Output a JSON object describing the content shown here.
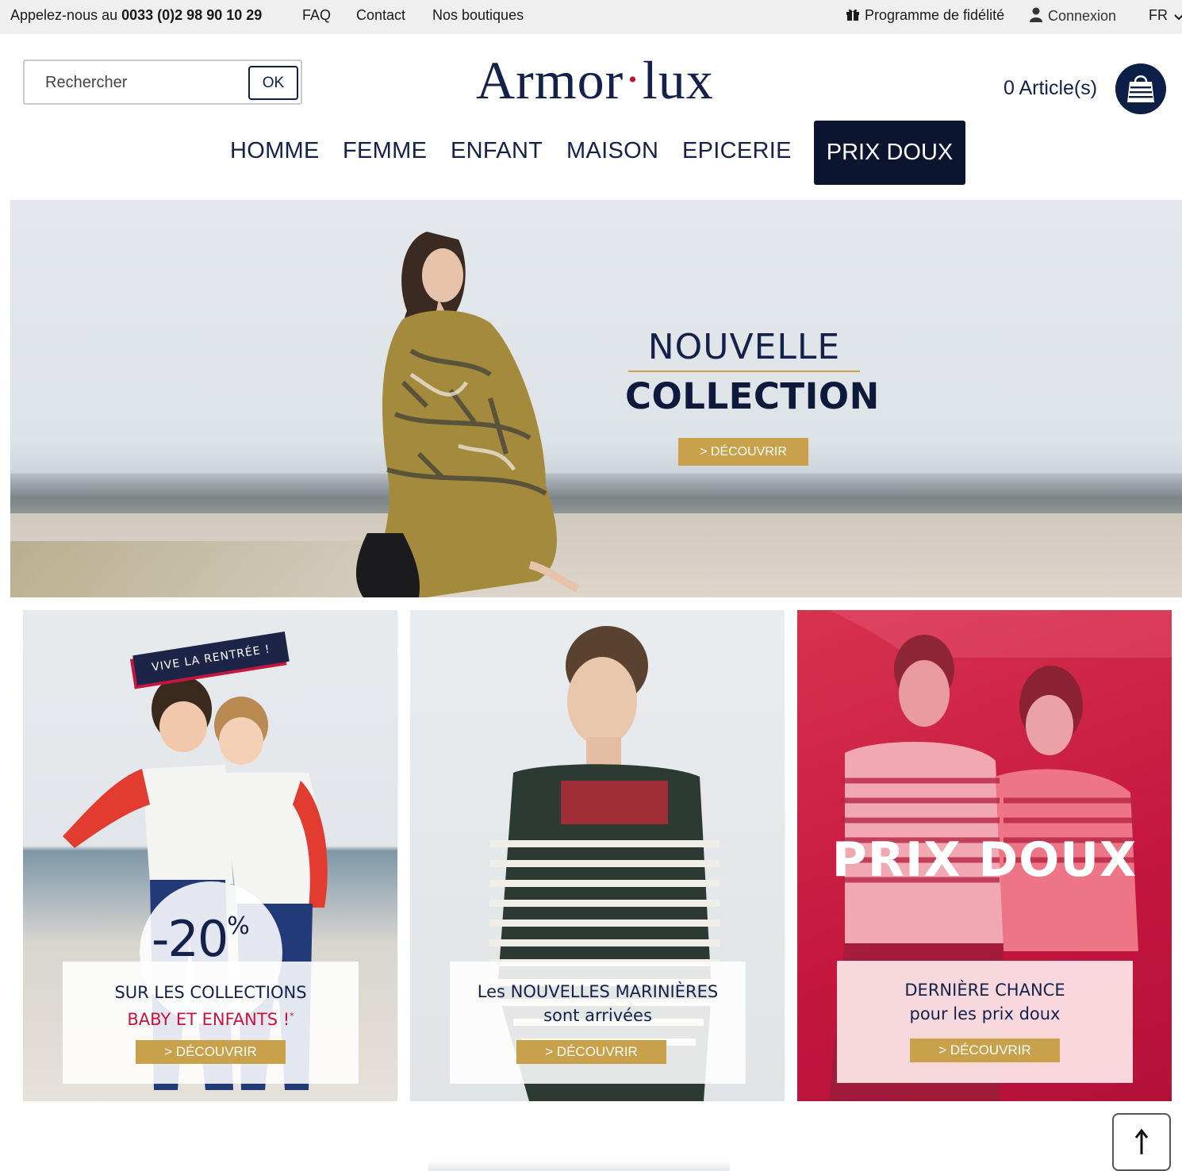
{
  "topbar": {
    "phone_prefix": "Appelez-nous au",
    "phone_number": "0033 (0)2 98 90 10 29",
    "links": [
      "FAQ",
      "Contact",
      "Nos boutiques"
    ],
    "loyalty": "Programme de fidélité",
    "login": "Connexion",
    "language": "FR"
  },
  "search": {
    "placeholder": "Rechercher",
    "button": "OK"
  },
  "logo": {
    "part1": "Armor",
    "dot": "•",
    "part2": "lux"
  },
  "cart": {
    "count_label": "0 Article(s)"
  },
  "nav": {
    "items": [
      "HOMME",
      "FEMME",
      "ENFANT",
      "MAISON",
      "EPICERIE"
    ],
    "active": "PRIX DOUX"
  },
  "hero": {
    "line1": "NOUVELLE",
    "line2": "COLLECTION",
    "cta": "> DÉCOUVRIR"
  },
  "cards": [
    {
      "ribbon": "VIVE LA RENTRÉE !",
      "promo": "-20",
      "promo_unit": "%",
      "line1": "SUR LES COLLECTIONS",
      "line2": "BABY ET ENFANTS !",
      "line2_mark": "*",
      "cta": "> DÉCOUVRIR"
    },
    {
      "line1": "Les NOUVELLES MARINIÈRES",
      "line2": "sont arrivées",
      "cta": "> DÉCOUVRIR"
    },
    {
      "headline": "PRIX DOUX",
      "line1": "DERNIÈRE CHANCE",
      "line2": "pour les prix doux",
      "cta": "> DÉCOUVRIR"
    }
  ],
  "colors": {
    "navy": "#0e1f47",
    "gold": "#c9a14a",
    "red": "#c4163e",
    "topbar": "#efefef"
  },
  "icons": {
    "gift": "gift-icon",
    "user": "user-icon",
    "chevron": "chevron-down-icon",
    "bag": "shopping-bag-icon",
    "arrow": "arrow-up-icon"
  }
}
